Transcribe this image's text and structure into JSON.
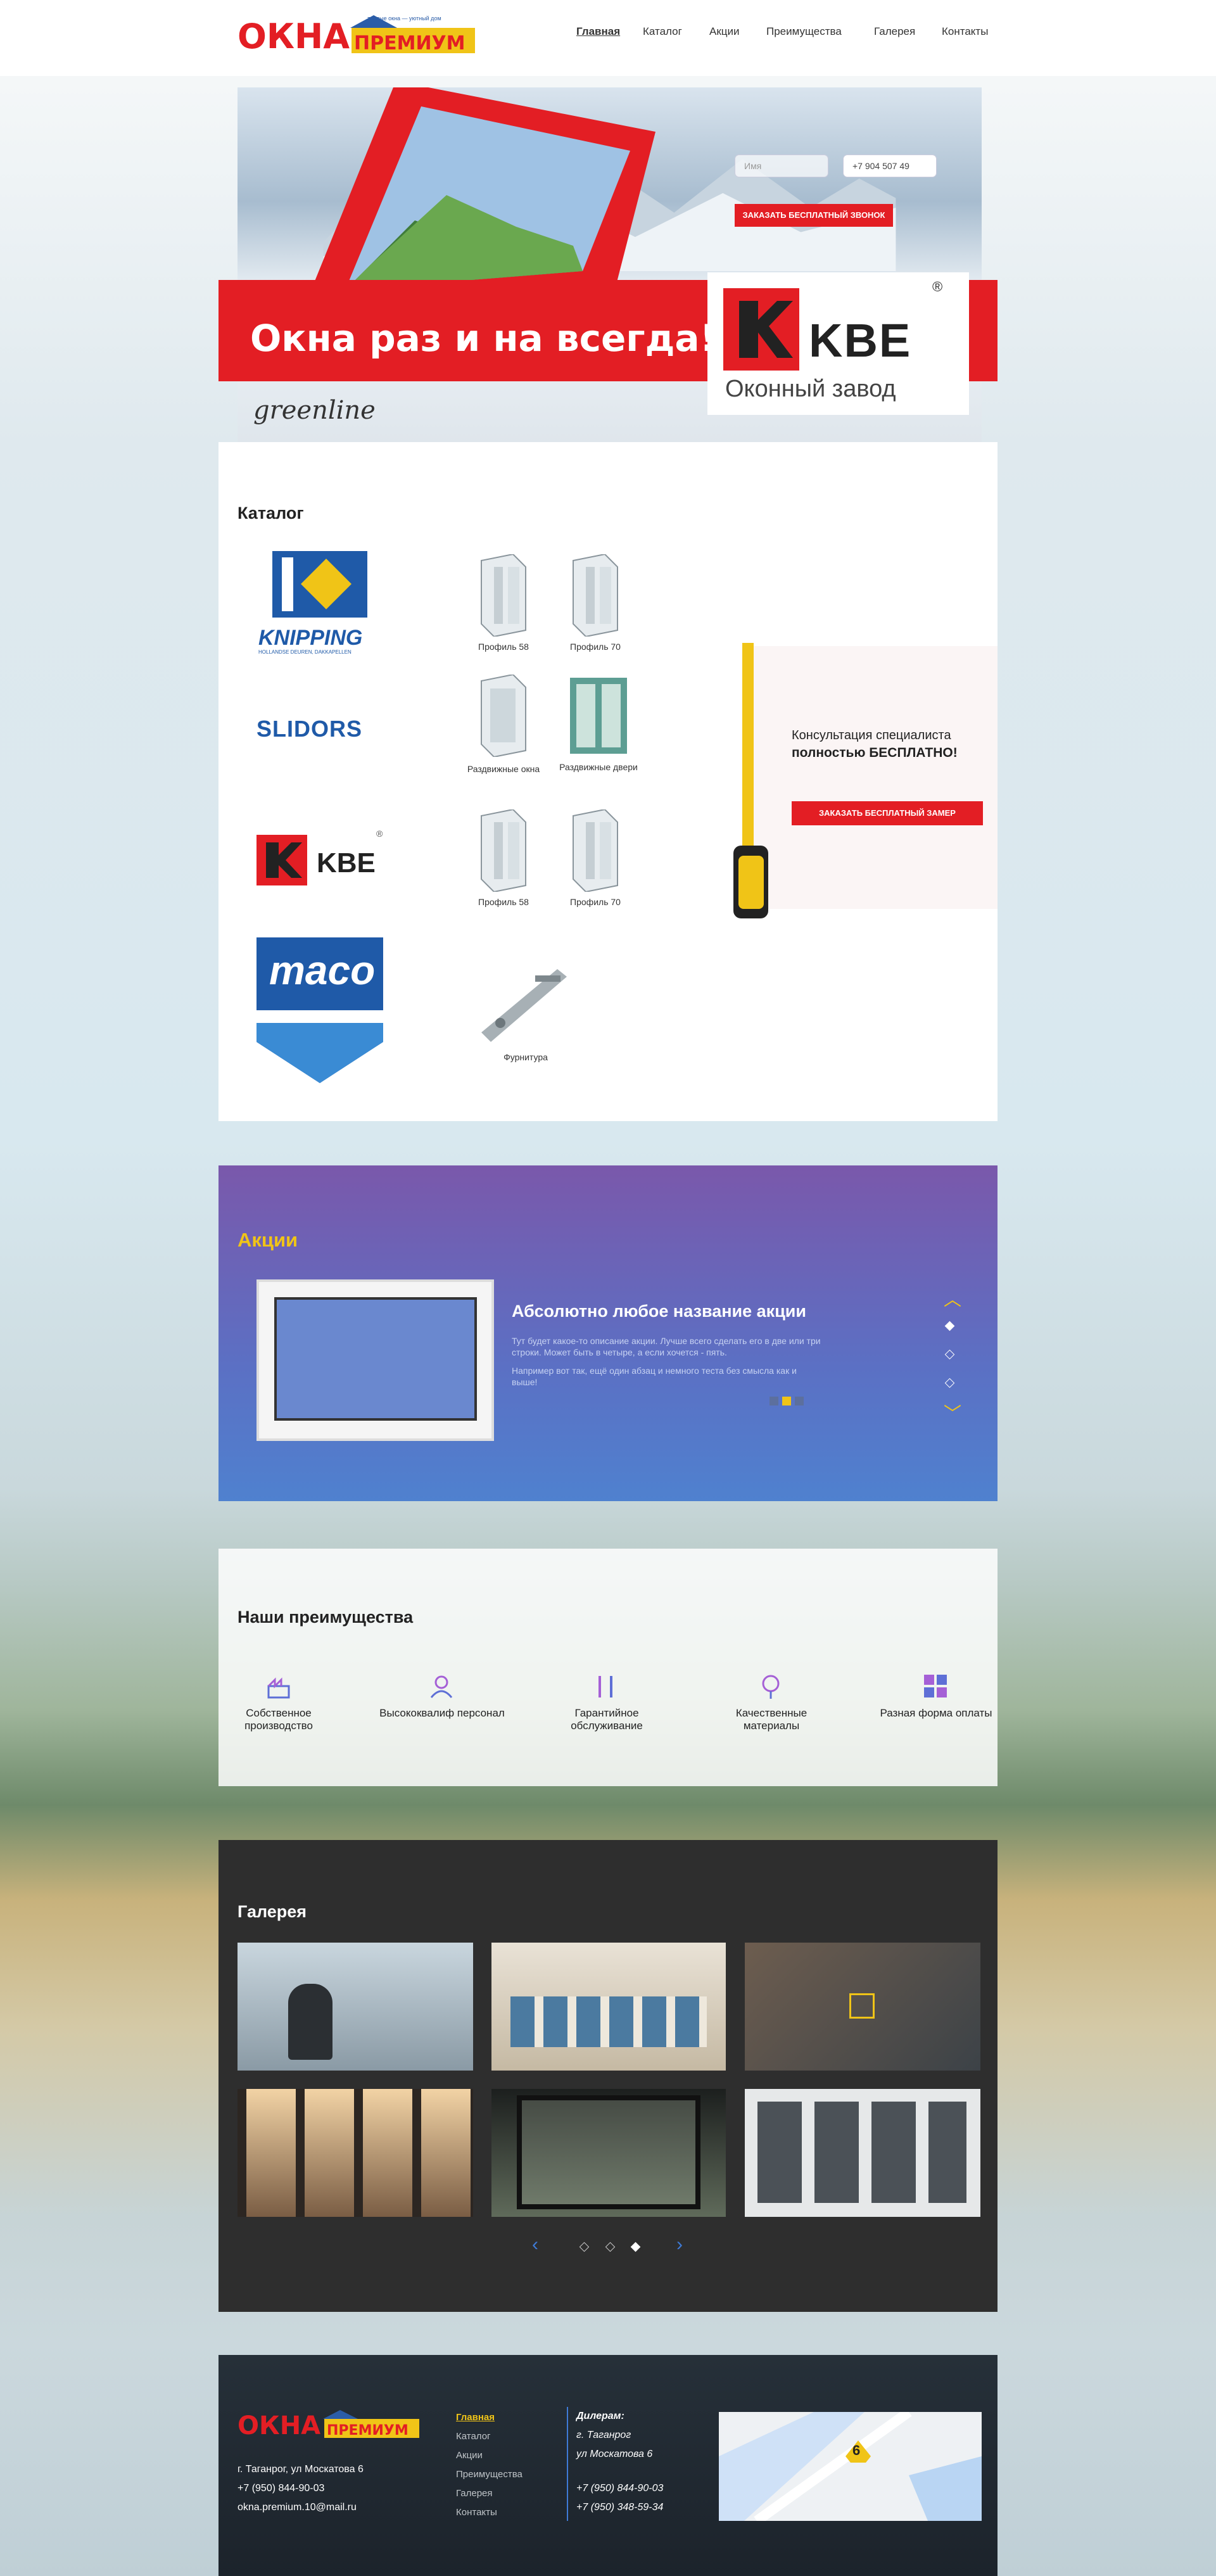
{
  "header": {
    "logo": {
      "part1": "ОКНА",
      "part2": "ПРЕМИУМ",
      "tagline": "теплые окна — уютный дом"
    },
    "nav": [
      {
        "label": "Главная",
        "active": true
      },
      {
        "label": "Каталог"
      },
      {
        "label": "Акции"
      },
      {
        "label": "Преимущества"
      },
      {
        "label": "Галерея"
      },
      {
        "label": "Контакты"
      }
    ]
  },
  "hero": {
    "name_placeholder": "Имя",
    "phone_value": "+7 904 507 49",
    "callback_button": "ЗАКАЗАТЬ БЕСПЛАТНЫЙ ЗВОНОК",
    "headline": "Окна раз и на всегда!",
    "brand_left": "greenline",
    "kbe_logo": "KBE",
    "kbe_subtitle": "Оконный завод",
    "registered_mark": "®"
  },
  "catalog": {
    "title": "Каталог",
    "brands": [
      {
        "name": "KNIPPING",
        "sub": "HOLLANDSE DEUREN, DAKKAPELLEN"
      },
      {
        "name": "SLIDORS"
      },
      {
        "name": "KBE",
        "mark": "®"
      },
      {
        "name": "maco"
      }
    ],
    "items": [
      {
        "label": "Профиль 58"
      },
      {
        "label": "Профиль 70"
      },
      {
        "label": "Раздвижные окна"
      },
      {
        "label": "Раздвижные двери"
      },
      {
        "label": "Профиль 58"
      },
      {
        "label": "Профиль 70"
      },
      {
        "label": "Фурнитура"
      }
    ],
    "consult": {
      "line1": "Консультация специалиста",
      "line2": "полностью БЕСПЛАТНО!",
      "button": "ЗАКАЗАТЬ БЕСПЛАТНЫЙ ЗАМЕР"
    }
  },
  "promo": {
    "title": "Акции",
    "headline": "Абсолютно любое название акции",
    "text1": "Тут будет какое-то описание акции. Лучше всего сделать его в две или три строки. Может быть в четыре, а если хочется - пять.",
    "text2": "Например вот так, ещё один абзац и немного теста без смысла как и выше!",
    "share_icons": [
      "facebook-icon",
      "vk-icon",
      "twitter-icon"
    ],
    "slides": 3,
    "active_slide": 1
  },
  "advantages": {
    "title": "Наши преимущества",
    "items": [
      {
        "label": "Собственное производство",
        "icon": "factory-icon"
      },
      {
        "label": "Высококвалифицированный персонал",
        "display": "Высококвалиф персонал",
        "icon": "worker-icon"
      },
      {
        "label": "Гарантийное обслуживание",
        "icon": "tools-icon"
      },
      {
        "label": "Качественные материалы",
        "icon": "quality-icon"
      },
      {
        "label": "Разная форма оплаты",
        "icon": "payment-icon"
      }
    ]
  },
  "gallery": {
    "title": "Галерея",
    "photos": [
      "woman-at-window",
      "classic-facade",
      "balcony-windows",
      "city-view-windows",
      "dark-window-forest",
      "modern-facade-boxes"
    ],
    "pages": 3,
    "active_page": 3
  },
  "footer": {
    "logo": {
      "part1": "ОКНА",
      "part2": "ПРЕМИУМ"
    },
    "address": "г. Таганрог, ул Москатова 6",
    "phone": "+7 (950) 844-90-03",
    "email": "okna.premium.10@mail.ru",
    "nav": [
      "Главная",
      "Каталог",
      "Акции",
      "Преимущества",
      "Галерея",
      "Контакты"
    ],
    "dealer_title": "Дилерам:",
    "dealer_city": "г. Таганрог",
    "dealer_address": "ул Москатова 6",
    "dealer_phone1": "+7 (950) 844-90-03",
    "dealer_phone2": "+7 (950) 348-59-34",
    "map_marker": "6"
  },
  "colors": {
    "brand_red": "#e31e24",
    "accent_yellow": "#f0c417",
    "promo_purple": "#6f5aa9",
    "promo_blue": "#4f81cf",
    "footer_dark": "#1f272e"
  }
}
